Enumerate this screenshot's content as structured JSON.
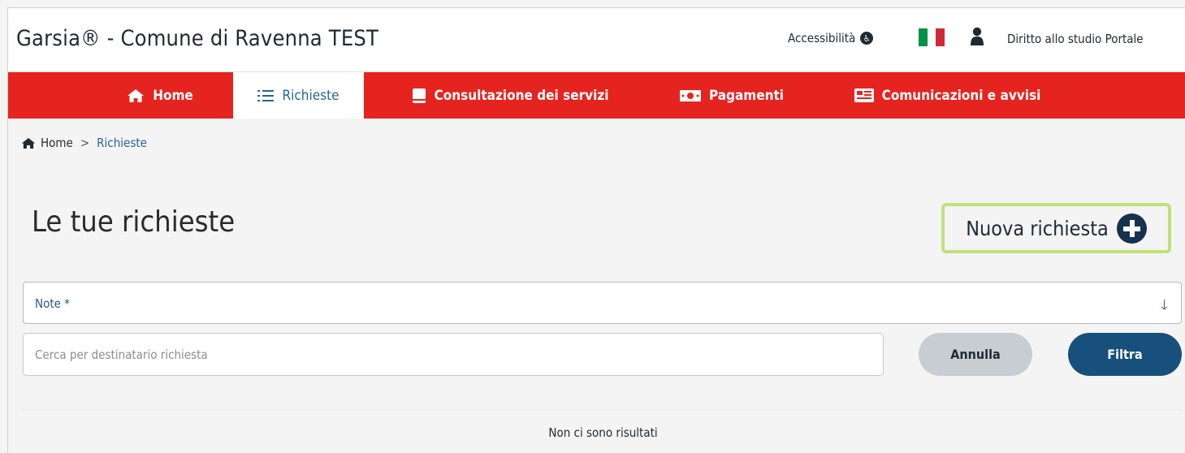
{
  "header": {
    "app_title": "Garsia® - Comune di Ravenna TEST",
    "accessibility_label": "Accessibilità",
    "portal_link": "Diritto allo studio Portale",
    "flag_colors": [
      "#009246",
      "#ffffff",
      "#ce2b37"
    ]
  },
  "nav": {
    "items": [
      {
        "label": "Home",
        "icon": "home-icon"
      },
      {
        "label": "Richieste",
        "icon": "list-icon",
        "active": true
      },
      {
        "label": "Consultazione dei servizi",
        "icon": "book-icon"
      },
      {
        "label": "Pagamenti",
        "icon": "money-icon"
      },
      {
        "label": "Comunicazioni e avvisi",
        "icon": "newspaper-icon"
      }
    ],
    "background_color": "#e52420",
    "active_color": "#2a6592"
  },
  "breadcrumb": {
    "home": "Home",
    "separator": ">",
    "current": "Richieste"
  },
  "page": {
    "title": "Le tue richieste",
    "new_request_label": "Nuova richiesta"
  },
  "filters": {
    "note_label": "Note *",
    "search_placeholder": "Cerca per destinatario richiesta",
    "search_value": "",
    "cancel_label": "Annulla",
    "filter_label": "Filtra"
  },
  "results": {
    "empty_message": "Non ci sono risultati"
  },
  "highlight_color": "#c2e07a"
}
